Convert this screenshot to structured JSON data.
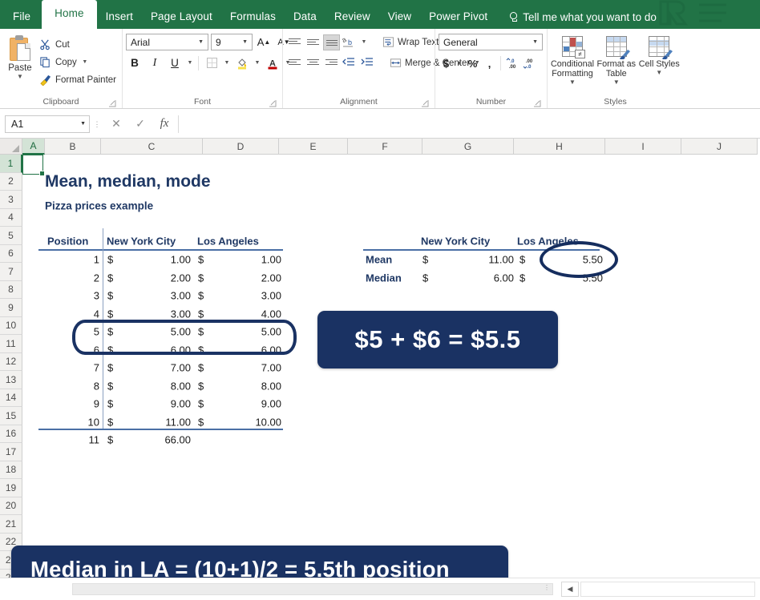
{
  "app": {
    "name": "Microsoft Excel",
    "accent_green": "#217346",
    "annotation_navy": "#1a3263",
    "sheet_heading_color": "#1f3864"
  },
  "ribbon": {
    "tabs": [
      {
        "label": "File",
        "active": false
      },
      {
        "label": "Home",
        "active": true
      },
      {
        "label": "Insert",
        "active": false
      },
      {
        "label": "Page Layout",
        "active": false
      },
      {
        "label": "Formulas",
        "active": false
      },
      {
        "label": "Data",
        "active": false
      },
      {
        "label": "Review",
        "active": false
      },
      {
        "label": "View",
        "active": false
      },
      {
        "label": "Power Pivot",
        "active": false
      }
    ],
    "tell_me": "Tell me what you want to do",
    "groups": {
      "clipboard": {
        "name": "Clipboard",
        "paste": "Paste",
        "cut": "Cut",
        "copy": "Copy",
        "format_painter": "Format Painter"
      },
      "font": {
        "name": "Font",
        "font_family_value": "Arial",
        "font_size_value": "9",
        "bold": "B",
        "italic": "I",
        "underline": "U",
        "grow_font": "A",
        "shrink_font": "A",
        "fill_color": "A",
        "font_color": "A"
      },
      "alignment": {
        "name": "Alignment",
        "wrap_text": "Wrap Text",
        "merge_center": "Merge & Center"
      },
      "number": {
        "name": "Number",
        "format_value": "General",
        "accounting": "$",
        "percent": "%",
        "comma": ",",
        "increase_decimal": ".00",
        "decrease_decimal": ".00"
      },
      "styles": {
        "name": "Styles",
        "conditional_formatting": "Conditional Formatting",
        "format_as_table": "Format as Table",
        "cell_styles": "Cell Styles"
      }
    }
  },
  "formula_bar": {
    "name_box_value": "A1",
    "formula_value": "",
    "cancel_icon": "✕",
    "enter_icon": "✓",
    "fx_icon": "fx"
  },
  "grid": {
    "columns": [
      "A",
      "B",
      "C",
      "D",
      "E",
      "F",
      "G",
      "H",
      "I",
      "J"
    ],
    "selected_column": "A",
    "rows": [
      "1",
      "2",
      "3",
      "4",
      "5",
      "6",
      "7",
      "8",
      "9",
      "10",
      "11",
      "12",
      "13",
      "14",
      "15",
      "16",
      "17",
      "18",
      "19",
      "20",
      "21",
      "22",
      "23",
      "24"
    ],
    "selected_row": "1",
    "selected_cell": "A1"
  },
  "sheet": {
    "title": "Mean, median, mode",
    "subtitle": "Pizza prices example",
    "table": {
      "headers": [
        "Position",
        "New York City",
        "Los Angeles"
      ],
      "rows": [
        {
          "position": "1",
          "nyc_sym": "$",
          "nyc": "1.00",
          "la_sym": "$",
          "la": "1.00"
        },
        {
          "position": "2",
          "nyc_sym": "$",
          "nyc": "2.00",
          "la_sym": "$",
          "la": "2.00"
        },
        {
          "position": "3",
          "nyc_sym": "$",
          "nyc": "3.00",
          "la_sym": "$",
          "la": "3.00"
        },
        {
          "position": "4",
          "nyc_sym": "$",
          "nyc": "3.00",
          "la_sym": "$",
          "la": "4.00"
        },
        {
          "position": "5",
          "nyc_sym": "$",
          "nyc": "5.00",
          "la_sym": "$",
          "la": "5.00"
        },
        {
          "position": "6",
          "nyc_sym": "$",
          "nyc": "6.00",
          "la_sym": "$",
          "la": "6.00"
        },
        {
          "position": "7",
          "nyc_sym": "$",
          "nyc": "7.00",
          "la_sym": "$",
          "la": "7.00"
        },
        {
          "position": "8",
          "nyc_sym": "$",
          "nyc": "8.00",
          "la_sym": "$",
          "la": "8.00"
        },
        {
          "position": "9",
          "nyc_sym": "$",
          "nyc": "9.00",
          "la_sym": "$",
          "la": "9.00"
        },
        {
          "position": "10",
          "nyc_sym": "$",
          "nyc": "11.00",
          "la_sym": "$",
          "la": "10.00"
        },
        {
          "position": "11",
          "nyc_sym": "$",
          "nyc": "66.00",
          "la_sym": "",
          "la": ""
        }
      ]
    },
    "summary": {
      "headers": [
        "New York City",
        "Los Angeles"
      ],
      "rows": [
        {
          "label": "Mean",
          "nyc_sym": "$",
          "nyc": "11.00",
          "la_sym": "$",
          "la": "5.50"
        },
        {
          "label": "Median",
          "nyc_sym": "$",
          "nyc": "6.00",
          "la_sym": "$",
          "la": "5.50"
        }
      ]
    }
  },
  "annotations": {
    "callout_sum": "$5 + $6 = $5.5",
    "callout_median": "Median in LA = (10+1)/2 = 5.5th position",
    "highlight_rows": "positions 5 and 6",
    "circled_value": "5.50"
  }
}
